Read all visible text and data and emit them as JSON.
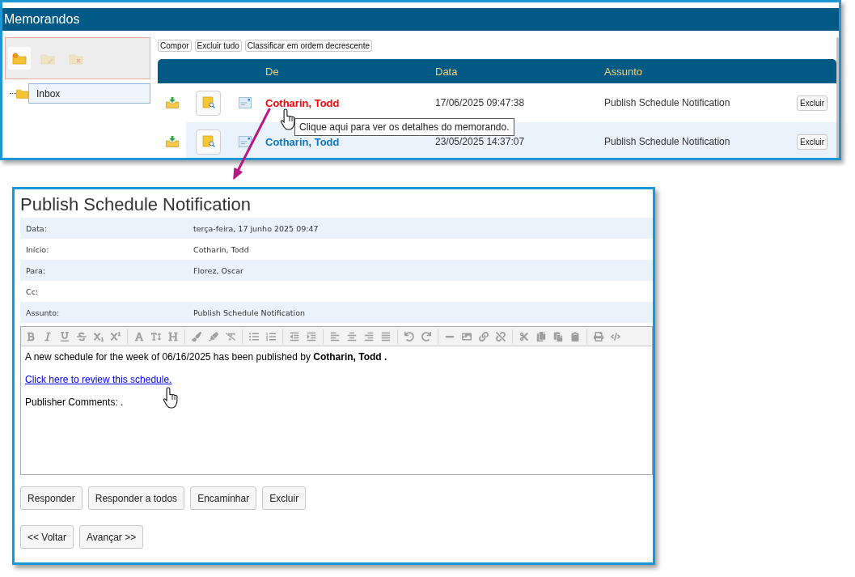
{
  "inbox_window": {
    "title": "Memorandos",
    "folder_tools": [
      {
        "kind": "new",
        "disabled": false
      },
      {
        "kind": "edit",
        "disabled": true
      },
      {
        "kind": "delete",
        "disabled": true
      }
    ],
    "folders": [
      {
        "label": "Inbox",
        "selected": true
      }
    ],
    "toolbar_buttons": [
      "Compor",
      "Excluir tudo",
      "Classificar em ordem decrescente"
    ],
    "table": {
      "columns": [
        "De",
        "Data",
        "Assunto"
      ],
      "rows": [
        {
          "from": "Cotharin, Todd",
          "date": "17/06/2025 09:47:38",
          "subject": "Publish Schedule Notification",
          "action": "Excluir",
          "hovered": true
        },
        {
          "from": "Cotharin, Todd",
          "date": "23/05/2025 14:37:07",
          "subject": "Publish Schedule Notification",
          "action": "Excluir",
          "hovered": false
        }
      ]
    },
    "tooltip": "Clique aqui para ver os detalhes do memorando."
  },
  "memo_window": {
    "title": "Publish Schedule Notification",
    "fields": [
      {
        "label": "Data:",
        "value": "terça-feira, 17 junho 2025 09:47"
      },
      {
        "label": "Início:",
        "value": "Cotharin, Todd"
      },
      {
        "label": "Para:",
        "value": "Florez, Oscar"
      },
      {
        "label": "Cc:"
      },
      {
        "label": "Assunto:",
        "value": "Publish Schedule Notification"
      }
    ],
    "body": [
      {
        "kind": "text",
        "text": "A new schedule for the week of 06/16/2025 has been published by **Cotharin, Todd .**"
      },
      {
        "kind": "link",
        "text": "Click here to review this schedule."
      },
      {
        "kind": "text",
        "text": "Publisher Comments: ."
      }
    ],
    "actions": [
      "Responder",
      "Responder a todos",
      "Encaminhar",
      "Excluir"
    ],
    "navigation": [
      "<< Voltar",
      "Avançar >>"
    ]
  }
}
